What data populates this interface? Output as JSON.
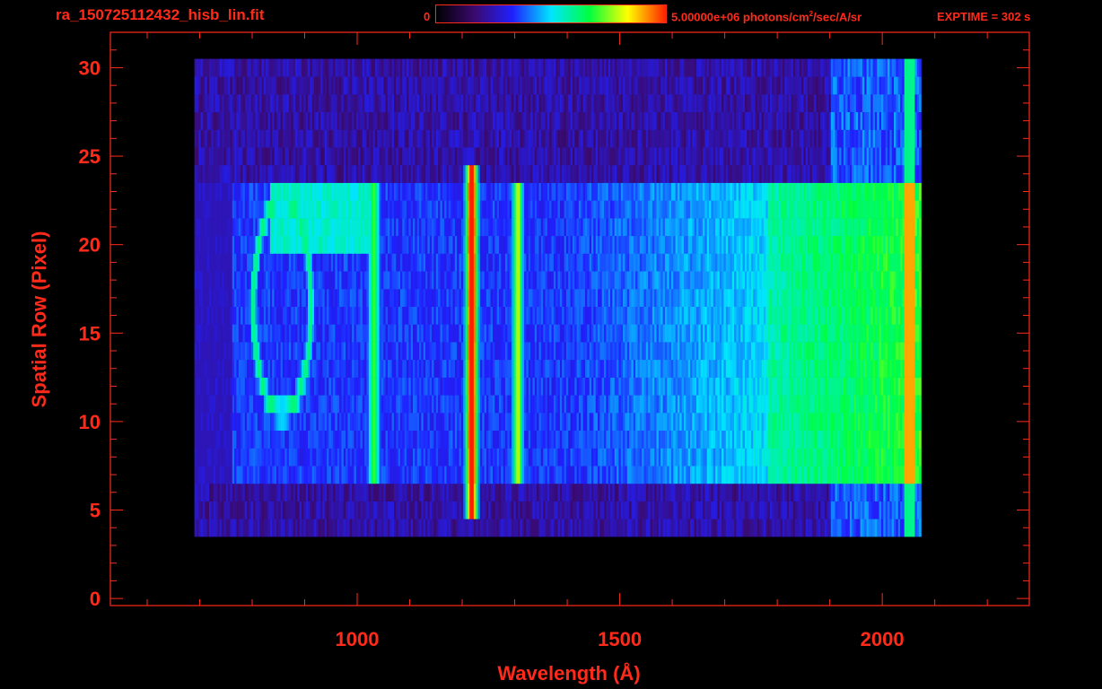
{
  "header": {
    "file_title": "ra_150725112432_hisb_lin.fit",
    "colorbar_min_label": "0",
    "colorbar_max_prefix": "5.00000e+06 photons/cm",
    "colorbar_max_exponent": "2",
    "colorbar_max_suffix": "/sec/A/sr",
    "exptime_label": "EXPTIME = 302 s"
  },
  "colors": {
    "axis": "#ff2a1a",
    "background": "#000000",
    "colormap": [
      "#000000",
      "#3a0a6e",
      "#2020ff",
      "#00e5ff",
      "#00ff40",
      "#ffff00",
      "#ff2000"
    ]
  },
  "chart_data": {
    "type": "heatmap",
    "title": "ra_150725112432_hisb_lin.fit",
    "xlabel": "Wavelength (Å)",
    "ylabel": "Spatial Row (Pixel)",
    "xlim": [
      530,
      2280
    ],
    "ylim": [
      -0.4,
      32
    ],
    "x_ticks": [
      1000,
      1500,
      2000
    ],
    "y_ticks": [
      0,
      5,
      10,
      15,
      20,
      25,
      30
    ],
    "colorscale_range": [
      0,
      5000000
    ],
    "colorscale_units": "photons/cm^2/sec/A/sr",
    "grid": false,
    "data_extent": {
      "x": [
        690,
        2060
      ],
      "y": [
        4,
        30
      ]
    },
    "features": [
      {
        "name": "bright slit band",
        "y_range": [
          7,
          23
        ],
        "level": "cyan-green, rising to yellow above 1800 Å"
      },
      {
        "name": "Lyman-alpha line",
        "x": 1216,
        "y_range": [
          5,
          24
        ],
        "level": "saturated red"
      },
      {
        "name": "O I line",
        "x": 1304,
        "y_range": [
          7,
          23
        ],
        "level": "cyan"
      },
      {
        "name": "loop / ring feature",
        "x_range": [
          820,
          900
        ],
        "y_range": [
          10,
          23
        ],
        "level": "green-yellow"
      },
      {
        "name": "long-wavelength edge",
        "x": 2060,
        "y_range": [
          2,
          30
        ],
        "level": "red/yellow"
      }
    ]
  }
}
